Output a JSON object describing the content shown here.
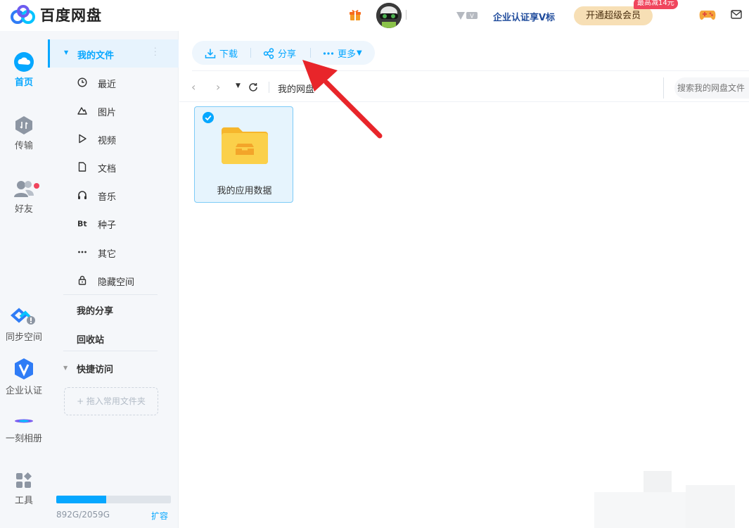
{
  "app": {
    "name": "百度网盘"
  },
  "header": {
    "enterprise_link": "企业认证享V标",
    "super_vip_button": "开通超级会员",
    "discount_badge": "最高减14元"
  },
  "rail": {
    "items": [
      {
        "label": "首页",
        "icon": "cloud-icon",
        "active": true
      },
      {
        "label": "传输",
        "icon": "transfer-icon"
      },
      {
        "label": "好友",
        "icon": "friends-icon"
      },
      {
        "label": "同步空间",
        "icon": "sync-icon"
      },
      {
        "label": "企业认证",
        "icon": "v-badge-icon"
      },
      {
        "label": "一刻相册",
        "icon": "album-icon"
      },
      {
        "label": "工具",
        "icon": "tools-icon"
      }
    ]
  },
  "sidebar": {
    "my_files": "我的文件",
    "categories": [
      {
        "label": "最近",
        "icon": "clock-icon"
      },
      {
        "label": "图片",
        "icon": "mountain-icon"
      },
      {
        "label": "视频",
        "icon": "play-icon"
      },
      {
        "label": "文档",
        "icon": "document-icon"
      },
      {
        "label": "音乐",
        "icon": "headphones-icon"
      },
      {
        "label": "种子",
        "icon": "bt-icon"
      },
      {
        "label": "其它",
        "icon": "more-dots-icon"
      },
      {
        "label": "隐藏空间",
        "icon": "lock-icon"
      }
    ],
    "my_share": "我的分享",
    "recycle_bin": "回收站",
    "quick_access": "快捷访问",
    "drop_hint": "+ 拖入常用文件夹",
    "storage": {
      "text": "892G/2059G",
      "used_fraction": 0.433,
      "expand": "扩容"
    }
  },
  "toolbar": {
    "download": "下载",
    "share": "分享",
    "more": "更多"
  },
  "navbar": {
    "breadcrumb": "我的网盘",
    "search_placeholder": "搜索我的网盘文件"
  },
  "files": [
    {
      "name": "我的应用数据",
      "type": "folder",
      "selected": true
    }
  ],
  "colors": {
    "accent": "#06a7ff",
    "vip_gold": "#f7dfb5",
    "badge_red": "#f0455d",
    "annotation_red": "#e8252a",
    "folder_yellow": "#fbc93d"
  }
}
